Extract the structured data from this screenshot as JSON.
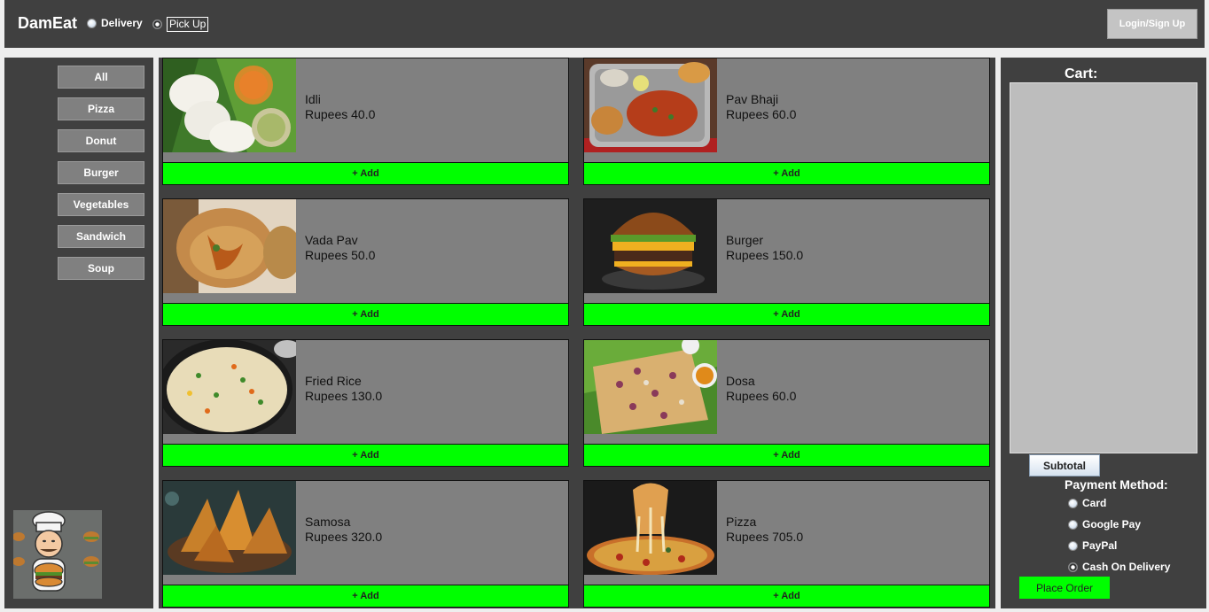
{
  "header": {
    "app_title": "DamEat",
    "delivery_label": "Delivery",
    "pickup_label": "Pick Up",
    "login_label": "Login/Sign Up"
  },
  "categories": [
    "All",
    "Pizza",
    "Donut",
    "Burger",
    "Vegetables",
    "Sandwich",
    "Soup"
  ],
  "menu": {
    "add_label": "+ Add",
    "items": [
      {
        "name": "Idli",
        "price": "Rupees 40.0",
        "image": "idli-photo"
      },
      {
        "name": "Pav Bhaji",
        "price": "Rupees 60.0",
        "image": "pav-bhaji-photo"
      },
      {
        "name": "Vada Pav",
        "price": "Rupees 50.0",
        "image": "vada-pav-photo"
      },
      {
        "name": "Burger",
        "price": "Rupees 150.0",
        "image": "burger-photo"
      },
      {
        "name": "Fried Rice",
        "price": "Rupees 130.0",
        "image": "fried-rice-photo"
      },
      {
        "name": "Dosa",
        "price": "Rupees 60.0",
        "image": "dosa-photo"
      },
      {
        "name": "Samosa",
        "price": "Rupees 320.0",
        "image": "samosa-photo"
      },
      {
        "name": "Pizza",
        "price": "Rupees 705.0",
        "image": "pizza-photo"
      }
    ]
  },
  "cart": {
    "title": "Cart:",
    "subtotal_label": "Subtotal",
    "payment_title": "Payment Method:",
    "payment_options": [
      "Card",
      "Google Pay",
      "PayPal",
      "Cash On Delivery"
    ],
    "place_order_label": "Place Order"
  },
  "colors": {
    "panel_bg": "#404040",
    "card_bg": "#808080",
    "add_button": "#00ff00"
  }
}
